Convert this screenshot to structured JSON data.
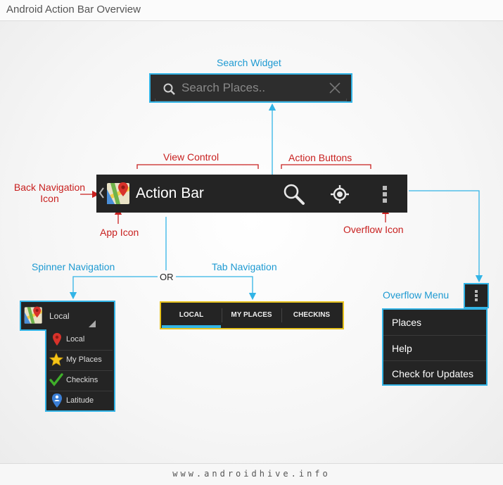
{
  "header": {
    "title": "Android Action Bar Overview"
  },
  "footer": {
    "site": "www.androidhive.info"
  },
  "labels": {
    "search_widget": "Search Widget",
    "view_control": "View Control",
    "action_buttons": "Action Buttons",
    "back_navigation_line1": "Back Navigation",
    "back_navigation_line2": "Icon",
    "app_icon": "App Icon",
    "overflow_icon": "Overflow Icon",
    "spinner_navigation": "Spinner Navigation",
    "tab_navigation": "Tab Navigation",
    "or": "OR",
    "overflow_menu": "Overflow Menu"
  },
  "search": {
    "placeholder": "Search Places.."
  },
  "action_bar": {
    "title": "Action Bar"
  },
  "spinner": {
    "selected": "Local",
    "items": [
      {
        "label": "Local",
        "icon": "map-pin-icon"
      },
      {
        "label": "My Places",
        "icon": "star-icon"
      },
      {
        "label": "Checkins",
        "icon": "checkmark-icon"
      },
      {
        "label": "Latitude",
        "icon": "latitude-person-icon"
      }
    ]
  },
  "tabs": [
    {
      "label": "LOCAL",
      "selected": true
    },
    {
      "label": "MY PLACES",
      "selected": false
    },
    {
      "label": "CHECKINS",
      "selected": false
    }
  ],
  "overflow_menu": {
    "items": [
      {
        "label": "Places"
      },
      {
        "label": "Help"
      },
      {
        "label": "Check for Updates"
      }
    ]
  },
  "colors": {
    "label_blue": "#1e9ad2",
    "label_red": "#c8201f",
    "widget_border_blue": "#32b4e6",
    "tab_border_yellow": "#e7c21d",
    "bar_dark": "#242424",
    "tab_indicator": "#33b5e5"
  }
}
